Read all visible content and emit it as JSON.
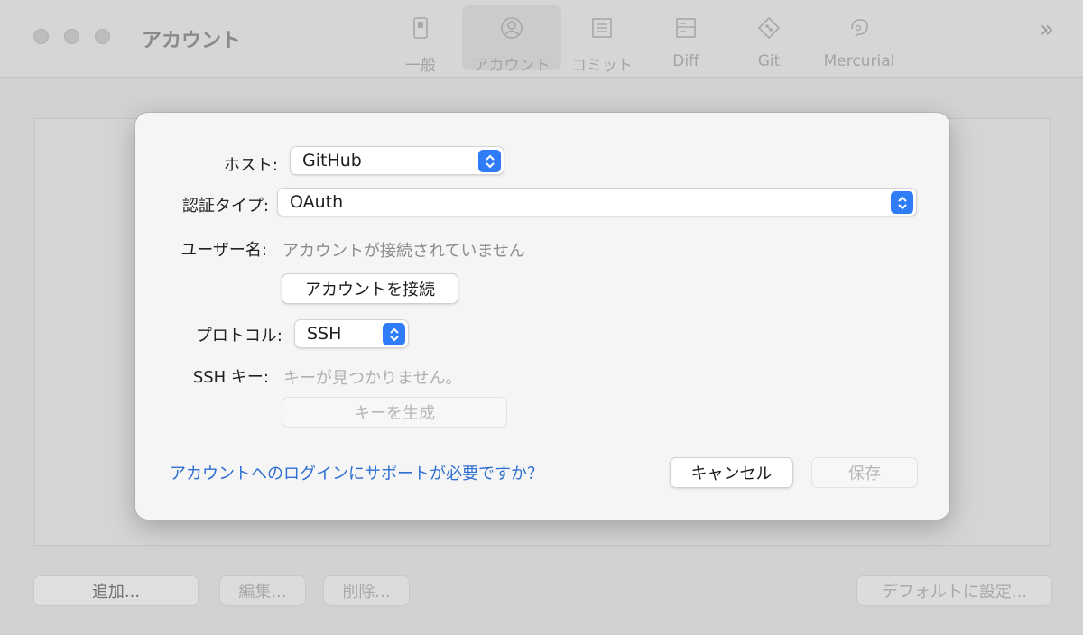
{
  "window": {
    "title": "アカウント"
  },
  "toolbar": {
    "items": [
      {
        "label": "一般",
        "icon": "switch-icon"
      },
      {
        "label": "アカウント",
        "icon": "person-circle-icon",
        "active": true
      },
      {
        "label": "コミット",
        "icon": "document-lines-icon"
      },
      {
        "label": "Diff",
        "icon": "diff-icon"
      },
      {
        "label": "Git",
        "icon": "git-diamond-icon"
      },
      {
        "label": "Mercurial",
        "icon": "mercurial-icon"
      }
    ],
    "overflow": "»"
  },
  "bottom_bar": {
    "add": "追加...",
    "edit": "編集...",
    "delete": "削除...",
    "set_default": "デフォルトに設定..."
  },
  "sheet": {
    "host_label": "ホスト:",
    "host_value": "GitHub",
    "auth_label": "認証タイプ:",
    "auth_value": "OAuth",
    "username_label": "ユーザー名:",
    "username_status": "アカウントが接続されていません",
    "connect_button": "アカウントを接続",
    "protocol_label": "プロトコル:",
    "protocol_value": "SSH",
    "sshkey_label": "SSH キー:",
    "sshkey_status": "キーが見つかりません。",
    "generate_key_button": "キーを生成",
    "help_link": "アカウントへのログインにサポートが必要ですか？",
    "cancel_button": "キャンセル",
    "save_button": "保存"
  },
  "colors": {
    "accent": "#2f7cf6",
    "link": "#2f6fd1"
  }
}
